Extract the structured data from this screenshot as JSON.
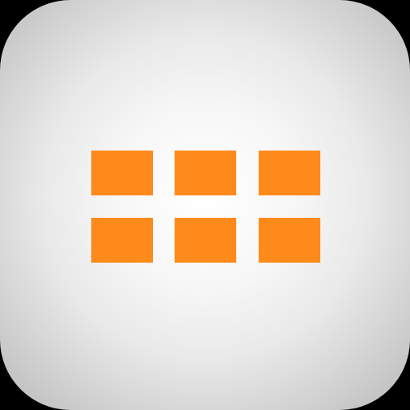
{
  "icon": {
    "name": "grid-icon",
    "tile_color": "#FF8A1C",
    "rows": 2,
    "columns": 3
  }
}
